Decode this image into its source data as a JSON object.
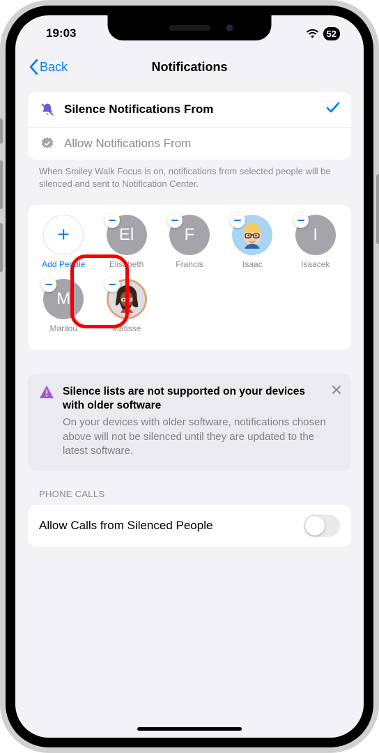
{
  "status": {
    "time": "19:03",
    "battery": "52"
  },
  "nav": {
    "back": "Back",
    "title": "Notifications"
  },
  "options": {
    "silence": {
      "label": "Silence Notifications From",
      "selected": true
    },
    "allow": {
      "label": "Allow Notifications From",
      "selected": false
    }
  },
  "explain": "When Smiley Walk Focus is on, notifications from selected people will be silenced and sent to Notification Center.",
  "people": {
    "add_label": "Add People",
    "list": [
      {
        "name": "Elisabeth",
        "initials": "El",
        "kind": "initials"
      },
      {
        "name": "Francis",
        "initials": "F",
        "kind": "initials"
      },
      {
        "name": "Isaac",
        "initials": "",
        "kind": "memoji-isaac"
      },
      {
        "name": "Isaacek",
        "initials": "I",
        "kind": "initials"
      },
      {
        "name": "Marilou",
        "initials": "M",
        "kind": "initials"
      },
      {
        "name": "Matisse",
        "initials": "",
        "kind": "memoji-matisse"
      }
    ]
  },
  "warning": {
    "title": "Silence lists are not supported on your devices with older software",
    "desc": "On your devices with older software, notifications chosen above will not be silenced until they are updated to the latest software."
  },
  "phone_calls": {
    "header": "PHONE CALLS",
    "allow_label": "Allow Calls from Silenced People",
    "allow_value": false
  }
}
